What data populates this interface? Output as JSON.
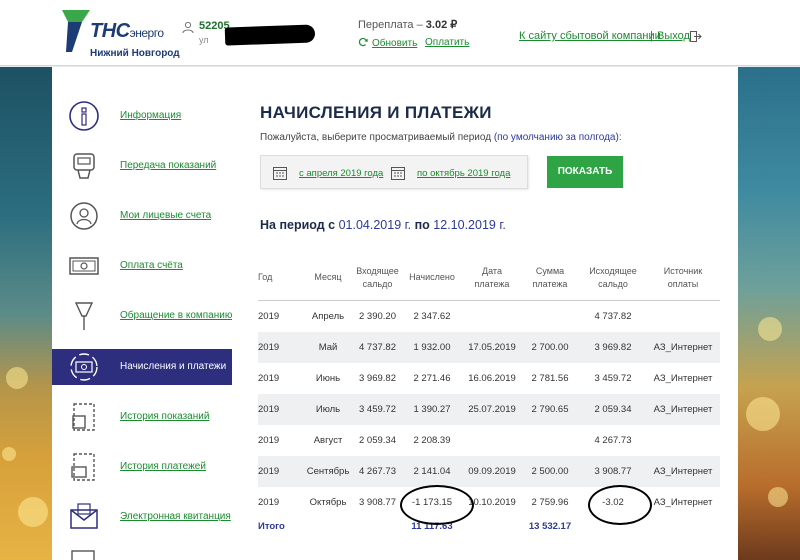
{
  "header": {
    "brand": "ТНС",
    "brand_suffix": "энерго",
    "city": "Нижний Новгород",
    "account_number": "52205",
    "account_address": "ул",
    "overpay_label": "Переплата –",
    "overpay_value": "3.02 ₽",
    "refresh_label": "Обновить",
    "pay_label": "Оплатить",
    "site_link": "К сайту сбытовой компании",
    "separator": "|",
    "logout_label": "Выход"
  },
  "sidebar": {
    "items": [
      {
        "label": "Информация",
        "icon": "info-icon"
      },
      {
        "label": "Передача показаний",
        "icon": "meter-icon"
      },
      {
        "label": "Мои лицевые счета",
        "icon": "accounts-icon"
      },
      {
        "label": "Оплата счёта",
        "icon": "banknote-icon"
      },
      {
        "label": "Обращение в компанию",
        "icon": "pen-icon"
      },
      {
        "label": "Начисления и платежи",
        "icon": "charges-icon",
        "active": true
      },
      {
        "label": "История показаний",
        "icon": "history-icon"
      },
      {
        "label": "История платежей",
        "icon": "payments-history-icon"
      },
      {
        "label": "Электронная квитанция",
        "icon": "envelope-icon"
      }
    ]
  },
  "main": {
    "title": "НАЧИСЛЕНИЯ И ПЛАТЕЖИ",
    "hint_text": "Пожалуйста, выберите просматриваемый период",
    "hint_link": "(по умолчанию за полгода)",
    "hint_colon": ":",
    "period_from": "с апреля 2019 года",
    "period_to": "по октябрь 2019 года",
    "show_button": "ПОКАЗАТЬ",
    "period_prefix": "На период с",
    "period_start": "01.04.2019 г.",
    "period_middle": "по",
    "period_end": "12.10.2019 г."
  },
  "table": {
    "headers": [
      [
        "Год"
      ],
      [
        "Месяц"
      ],
      [
        "Входящее",
        "сальдо"
      ],
      [
        "Начислено"
      ],
      [
        "Дата",
        "платежа"
      ],
      [
        "Сумма",
        "платежа"
      ],
      [
        "Исходящее",
        "сальдо"
      ],
      [
        "Источник",
        "оплаты"
      ]
    ],
    "rows": [
      [
        "2019",
        "Апрель",
        "2 390.20",
        "2 347.62",
        "",
        "",
        "4 737.82",
        ""
      ],
      [
        "2019",
        "Май",
        "4 737.82",
        "1 932.00",
        "17.05.2019",
        "2 700.00",
        "3 969.82",
        "АЗ_Интернет"
      ],
      [
        "2019",
        "Июнь",
        "3 969.82",
        "2 271.46",
        "16.06.2019",
        "2 781.56",
        "3 459.72",
        "АЗ_Интернет"
      ],
      [
        "2019",
        "Июль",
        "3 459.72",
        "1 390.27",
        "25.07.2019",
        "2 790.65",
        "2 059.34",
        "АЗ_Интернет"
      ],
      [
        "2019",
        "Август",
        "2 059.34",
        "2 208.39",
        "",
        "",
        "4 267.73",
        ""
      ],
      [
        "2019",
        "Сентябрь",
        "4 267.73",
        "2 141.04",
        "09.09.2019",
        "2 500.00",
        "3 908.77",
        "АЗ_Интернет"
      ],
      [
        "2019",
        "Октябрь",
        "3 908.77",
        "-1 173.15",
        "10.10.2019",
        "2 759.96",
        "-3.02",
        "АЗ_Интернет"
      ]
    ],
    "total_label": "Итого",
    "total_charged": "11 117.63",
    "total_paid": "13 532.17"
  },
  "colors": {
    "accent_green": "#2ea445",
    "link_green": "#1b8b30",
    "active_nav": "#2d2e7e",
    "heading_navy": "#1d2b4a",
    "highlight_blue": "#2d3a9c"
  }
}
